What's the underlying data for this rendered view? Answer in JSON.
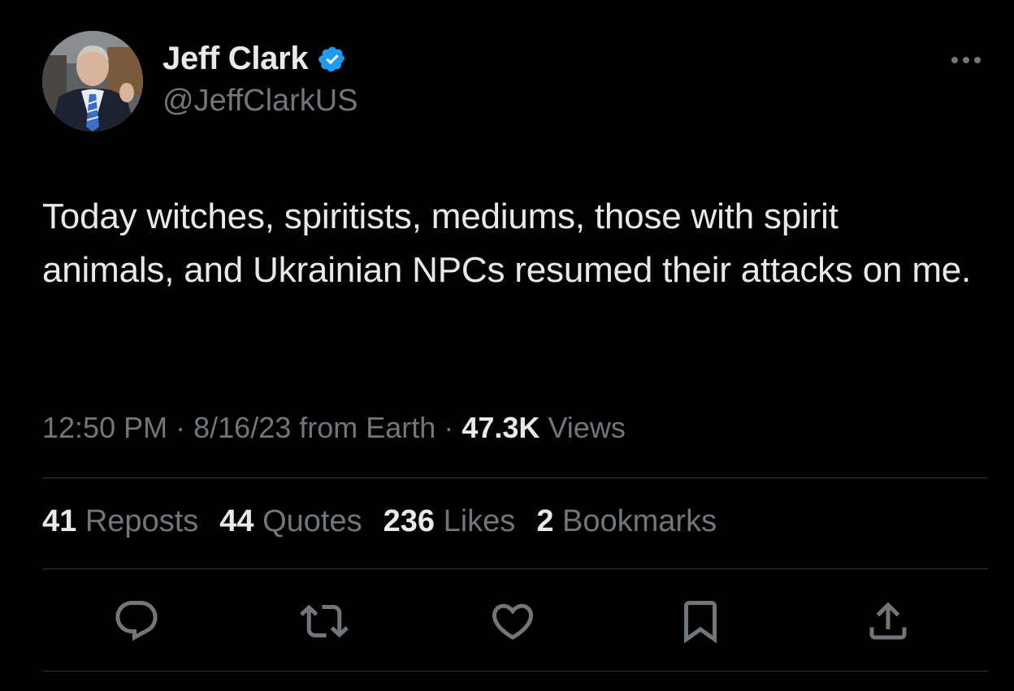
{
  "author": {
    "display_name": "Jeff Clark",
    "handle": "@JeffClarkUS",
    "verified": true
  },
  "tweet": {
    "text": "Today witches, spiritists, mediums, those with spirit animals, and Ukrainian NPCs resumed their attacks on me.",
    "time": "12:50 PM",
    "date": "8/16/23",
    "source": "from Earth",
    "separator": "·",
    "views_count": "47.3K",
    "views_label": "Views"
  },
  "stats": [
    {
      "count": "41",
      "label": "Reposts"
    },
    {
      "count": "44",
      "label": "Quotes"
    },
    {
      "count": "236",
      "label": "Likes"
    },
    {
      "count": "2",
      "label": "Bookmarks"
    }
  ],
  "actions": [
    "reply-icon",
    "repost-icon",
    "like-icon",
    "bookmark-icon",
    "share-icon"
  ],
  "colors": {
    "background": "#000000",
    "text_primary": "#e7e9ea",
    "text_secondary": "#71767b",
    "divider": "#2f3336",
    "verified": "#1d9bf0"
  }
}
